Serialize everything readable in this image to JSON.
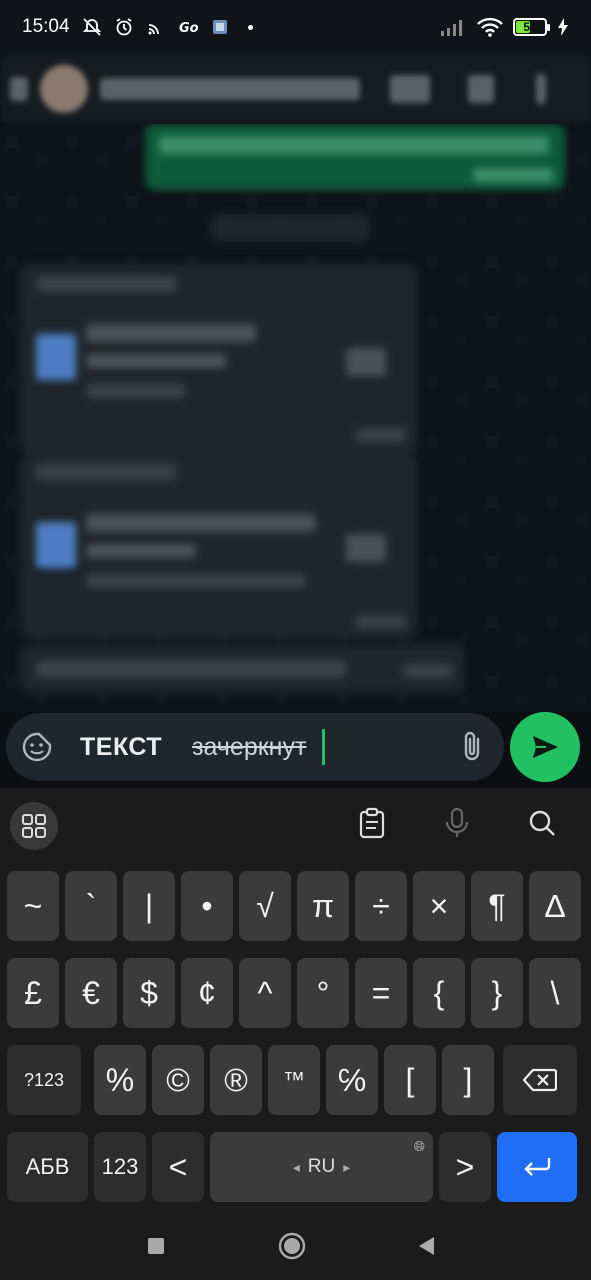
{
  "status_bar": {
    "time": "15:04",
    "battery_level": "51",
    "battery_fraction": 0.51,
    "icons": [
      "mute-alarm-icon",
      "alarm-icon",
      "cast-icon",
      "app-go-icon",
      "gallery-icon",
      "signal-icon",
      "wifi-icon",
      "battery-icon",
      "charging-icon"
    ]
  },
  "input": {
    "bold_text": "ТЕКСТ",
    "strike_text": "зачеркнут"
  },
  "keyboard": {
    "row1": [
      "~",
      "`",
      "|",
      "•",
      "√",
      "π",
      "÷",
      "×",
      "¶",
      "∆"
    ],
    "row2": [
      "£",
      "€",
      "$",
      "¢",
      "^",
      "°",
      "=",
      "{",
      "}",
      "\\"
    ],
    "row3_left": "?123",
    "row3": [
      "%",
      "©",
      "®",
      "™",
      "℅",
      "[",
      "]"
    ],
    "row4_left": "АБВ",
    "row4_num": "123",
    "row4_lt": "<",
    "space_label": "RU",
    "row4_gt": ">"
  },
  "colors": {
    "accent_green": "#21c063",
    "enter_blue": "#1f6ef5",
    "outgoing_bubble": "#0e5a3d"
  }
}
